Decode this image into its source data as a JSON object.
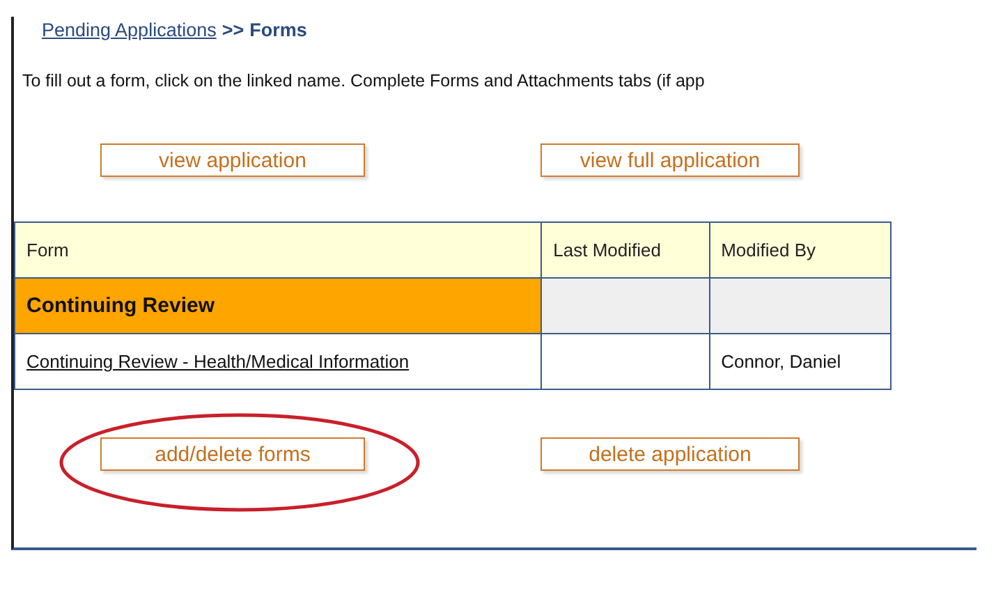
{
  "breadcrumb": {
    "link": "Pending Applications",
    "separator": ">>",
    "current": "Forms"
  },
  "instructions": "To fill out a form, click on the linked name. Complete Forms and Attachments tabs (if app",
  "top_buttons": [
    {
      "label": "view application",
      "highlighted": false
    },
    {
      "label": "view full application",
      "highlighted": false
    }
  ],
  "table": {
    "columns": [
      "Form",
      "Last Modified",
      "Modified By"
    ],
    "rows": [
      {
        "kind": "group",
        "cells": [
          "Continuing Review",
          "",
          ""
        ]
      },
      {
        "kind": "form",
        "cells": [
          "Continuing Review - Health/Medical Information",
          "",
          "Connor, Daniel"
        ]
      }
    ]
  },
  "bottom_buttons": [
    {
      "label": "add/delete forms",
      "highlighted": true
    },
    {
      "label": "delete application",
      "highlighted": false
    }
  ]
}
